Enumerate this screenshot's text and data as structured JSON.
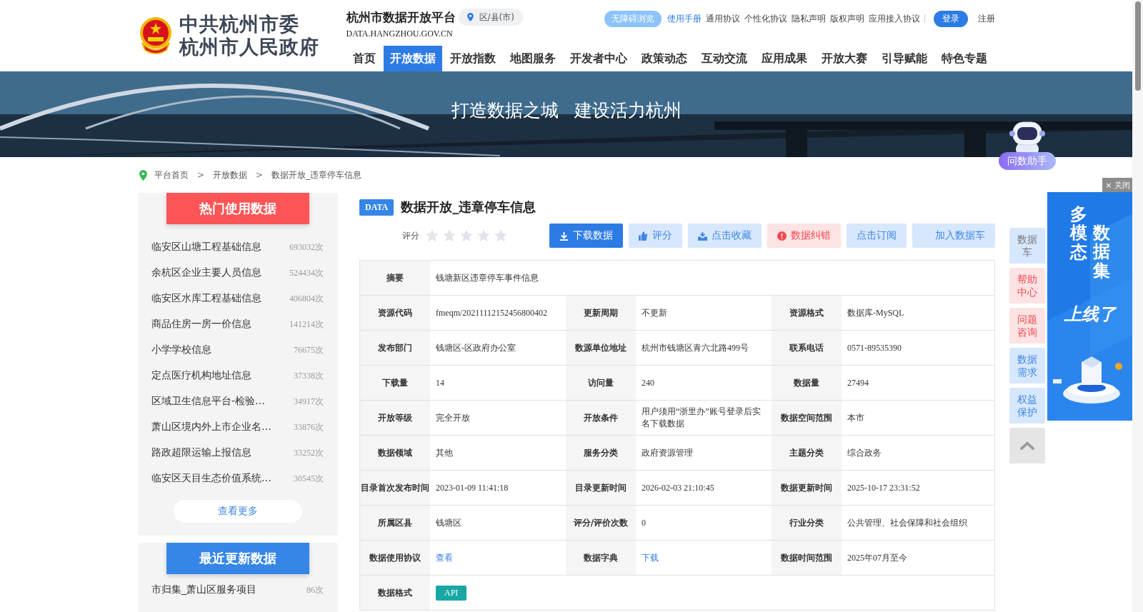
{
  "header": {
    "emblem_title_lines": [
      "中共杭州市委",
      "杭州市人民政府"
    ],
    "platform_title": "杭州市数据开放平台",
    "region_button": "区/县(市)",
    "domain": "DATA.HANGZHOU.GOV.CN",
    "top_links": [
      {
        "label": "无障碍浏览",
        "kind": "pill"
      },
      {
        "label": "使用手册",
        "kind": "highlight"
      },
      {
        "label": "通用协议",
        "kind": "plain"
      },
      {
        "label": "个性化协议",
        "kind": "plain"
      },
      {
        "label": "隐私声明",
        "kind": "plain"
      },
      {
        "label": "版权声明",
        "kind": "plain"
      },
      {
        "label": "应用接入协议",
        "kind": "plain"
      },
      {
        "label": "登录",
        "kind": "primary"
      },
      {
        "label": "注册",
        "kind": "plain"
      }
    ],
    "nav": [
      {
        "label": "首页",
        "selected": false
      },
      {
        "label": "开放数据",
        "selected": true
      },
      {
        "label": "开放指数",
        "selected": false
      },
      {
        "label": "地图服务",
        "selected": false
      },
      {
        "label": "开发者中心",
        "selected": false
      },
      {
        "label": "政策动态",
        "selected": false
      },
      {
        "label": "互动交流",
        "selected": false
      },
      {
        "label": "应用成果",
        "selected": false
      },
      {
        "label": "开放大赛",
        "selected": false
      },
      {
        "label": "引导赋能",
        "selected": false
      },
      {
        "label": "特色专题",
        "selected": false
      }
    ]
  },
  "banner": {
    "slogan": [
      "打造数据之城",
      "建设活力杭州"
    ]
  },
  "assistant": {
    "label": "问数助手"
  },
  "breadcrumb": {
    "separator": ">",
    "items": [
      "平台首页",
      "开放数据",
      "数据开放_违章停车信息"
    ]
  },
  "hot_data": {
    "title": "热门使用数据",
    "items": [
      {
        "name": "临安区山塘工程基础信息",
        "count": "693032次"
      },
      {
        "name": "余杭区企业主要人员信息",
        "count": "524434次"
      },
      {
        "name": "临安区水库工程基础信息",
        "count": "406804次"
      },
      {
        "name": "商品住房一房一价信息",
        "count": "141214次"
      },
      {
        "name": "小学学校信息",
        "count": "76675次"
      },
      {
        "name": "定点医疗机构地址信息",
        "count": "37338次"
      },
      {
        "name": "区域卫生信息平台-检验…",
        "count": "34917次"
      },
      {
        "name": "萧山区境内外上市企业名…",
        "count": "33876次"
      },
      {
        "name": "路政超限运输上报信息",
        "count": "33252次"
      },
      {
        "name": "临安区天目生态价值系统…",
        "count": "30545次"
      }
    ],
    "more": "查看更多"
  },
  "recent_data": {
    "title": "最近更新数据",
    "items": [
      {
        "name": "市归集_萧山区服务项目",
        "count": "86次"
      }
    ]
  },
  "dataset": {
    "tag": "DATA",
    "title": "数据开放_违章停车信息",
    "rating_label": "评分",
    "stars": 0,
    "actions": [
      {
        "label": "下载数据",
        "kind": "primary"
      },
      {
        "label": "评分",
        "kind": "light"
      },
      {
        "label": "点击收藏",
        "kind": "light"
      },
      {
        "label": "数据纠错",
        "kind": "danger"
      },
      {
        "label": "点击订阅",
        "kind": "light"
      },
      {
        "label": "加入数据车",
        "kind": "light"
      }
    ],
    "summary": {
      "label": "摘要",
      "value": "钱塘新区违章停车事件信息"
    },
    "rows": [
      [
        {
          "label": "资源代码",
          "value": "fmeqm/20211112152456800402"
        },
        {
          "label": "更新周期",
          "value": "不更新"
        },
        {
          "label": "资源格式",
          "value": "数据库-MySQL"
        }
      ],
      [
        {
          "label": "发布部门",
          "value": "钱塘区-区政府办公室"
        },
        {
          "label": "数源单位地址",
          "value": "杭州市钱塘区青六北路499号"
        },
        {
          "label": "联系电话",
          "value": "0571-89535390"
        }
      ],
      [
        {
          "label": "下载量",
          "value": "14"
        },
        {
          "label": "访问量",
          "value": "240"
        },
        {
          "label": "数据量",
          "value": "27494"
        }
      ],
      [
        {
          "label": "开放等级",
          "value": "完全开放"
        },
        {
          "label": "开放条件",
          "value": "用户须用“浙里办”账号登录后实名下载数据"
        },
        {
          "label": "数据空间范围",
          "value": "本市"
        }
      ],
      [
        {
          "label": "数据领域",
          "value": "其他"
        },
        {
          "label": "服务分类",
          "value": "政府资源管理"
        },
        {
          "label": "主题分类",
          "value": "综合政务"
        }
      ],
      [
        {
          "label": "目录首次发布时间",
          "value": "2023-01-09 11:41:18"
        },
        {
          "label": "目录更新时间",
          "value": "2026-02-03 21:10:45"
        },
        {
          "label": "数据更新时间",
          "value": "2025-10-17 23:31:52"
        }
      ],
      [
        {
          "label": "所属区县",
          "value": "钱塘区"
        },
        {
          "label": "评分/评价次数",
          "value": "0"
        },
        {
          "label": "行业分类",
          "value": "公共管理、社会保障和社会组织"
        }
      ],
      [
        {
          "label": "数据使用协议",
          "value": "查看",
          "kind": "link"
        },
        {
          "label": "数据字典",
          "value": "下载",
          "kind": "link"
        },
        {
          "label": "数据时间范围",
          "value": "2025年07月至今"
        }
      ]
    ],
    "format": {
      "label": "数据格式",
      "value": "API"
    }
  },
  "side_tools": [
    {
      "label": "数据车",
      "kind": "grey"
    },
    {
      "label": "帮助中心",
      "kind": "red"
    },
    {
      "label": "问题咨询",
      "kind": "red"
    },
    {
      "label": "数据需求",
      "kind": "blue"
    },
    {
      "label": "权益保护",
      "kind": "blue"
    }
  ],
  "ad": {
    "close": "× 关闭",
    "columns": [
      "多模态",
      "数据集"
    ],
    "tagline": "上线了"
  }
}
